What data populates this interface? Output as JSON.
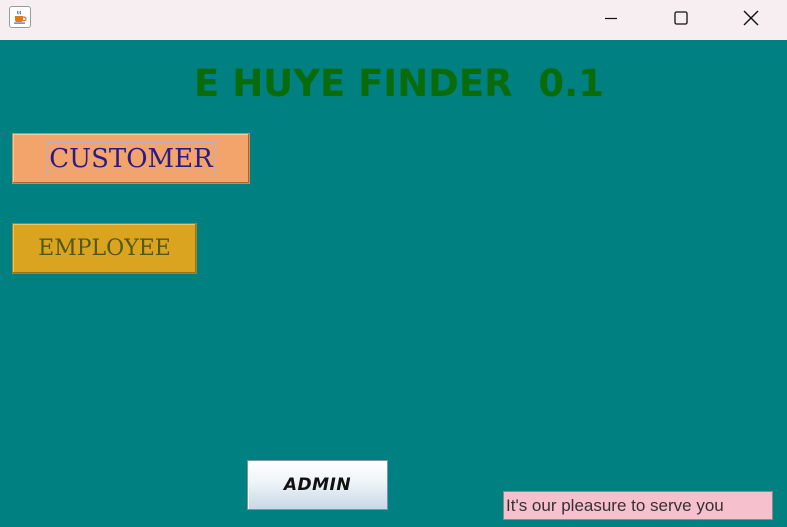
{
  "window": {
    "app_icon": "java-cup-icon",
    "controls": {
      "minimize_icon": "minimize-icon",
      "maximize_icon": "maximize-icon",
      "close_icon": "close-icon"
    }
  },
  "main": {
    "title": "E HUYE FINDER  0.1",
    "customer_button_label": "CUSTOMER",
    "employee_button_label": "EMPLOYEE",
    "admin_button_label": "ADMIN",
    "status_text": "It's our pleasure to serve you"
  },
  "colors": {
    "background": "#008080",
    "title_text": "#0a6b0a",
    "customer_button": "#f2a46a",
    "customer_text": "#2a1a8a",
    "employee_button": "#dba420",
    "employee_text": "#4f5a1a",
    "status_field": "#f7c0cd"
  }
}
